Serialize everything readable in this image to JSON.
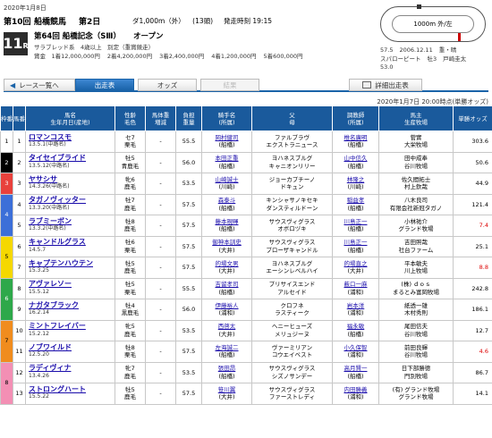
{
  "header": {
    "date": "2020年1月8日",
    "race_no": "第10回",
    "track": "船橋競馬",
    "day": "第2日",
    "distance": "ダ1,000m（外）",
    "runners": "(13頭)",
    "post_time": "発走時刻 19:15",
    "race_number_big": "11",
    "race_number_suffix": "R",
    "race_name": "第64回 船橋記念（SⅢ）",
    "race_class": "オープン",
    "conditions": "サラブレッド系　4歳以上　別定（重賞競走）",
    "prizes": [
      "賞金　1着12,000,000円",
      "2着4,200,000円",
      "3着2,400,000円",
      "4着1,200,000円",
      "5着600,000円"
    ]
  },
  "course": {
    "label": "1000m 外/左",
    "sub": "内"
  },
  "record": {
    "line1": [
      "57.5",
      "2006.12.11",
      "重・晴"
    ],
    "line2": [
      "スパローピート",
      "牡3",
      "戸崎圭太"
    ],
    "line3": [
      "53.0"
    ]
  },
  "nav": {
    "back": "レース一覧へ",
    "tabs": [
      "出走表",
      "オッズ",
      "結果"
    ],
    "detail": "詳細出走表"
  },
  "timestamp": "2020年1月7日 20:00時点(単勝オッズ)",
  "columns": [
    "枠番",
    "馬番",
    "馬名\n生年月日(産地)",
    "性齢\n毛色",
    "馬体重\n増減",
    "負担\n重量",
    "騎手名\n(所属)",
    "父\n母",
    "調教師\n(所属)",
    "馬主\n生産牧場",
    "単勝オッズ"
  ],
  "frame_colors": [
    "#ffffff",
    "#000000",
    "#e8413c",
    "#3c6fd8",
    "#f5d800",
    "#2ea84a",
    "#f08c1e",
    "#f38fb4"
  ],
  "rows": [
    {
      "waku": "1",
      "no": "1",
      "name": "ロマンコスモ",
      "birth": "13.5.1(中路名)",
      "sex": "セ7",
      "color": "栗毛",
      "wt": "-",
      "wtd": "",
      "load": "55.5",
      "jockey": "岡村健司",
      "jaff": "(船橋)",
      "sire": "ファルブラヴ",
      "dam": "エクストラニュース",
      "trainer": "椎名廣明",
      "taff": "(船橋)",
      "owner": "菅實",
      "farm": "大栄牧場",
      "odds": "303.6",
      "red": false
    },
    {
      "waku": "2",
      "no": "2",
      "name": "タイセイブライド",
      "birth": "13.5.12(中路名)",
      "sex": "牡5",
      "color": "青鹿毛",
      "wt": "-",
      "wtd": "",
      "load": "56.0",
      "jockey": "本田正重",
      "jaff": "(船橋)",
      "sire": "ヨハネスブルグ",
      "dam": "キャニオンリリー",
      "trainer": "山中信久",
      "taff": "(船橋)",
      "owner": "田中成奉",
      "farm": "谷川牧場",
      "odds": "50.6",
      "red": false
    },
    {
      "waku": "3",
      "no": "3",
      "name": "ヤサシサ",
      "birth": "14.3.26(中路名)",
      "sex": "牝6",
      "color": "鹿毛",
      "wt": "-",
      "wtd": "",
      "load": "53.5",
      "jockey": "山崎誠士",
      "jaff": "(川崎)",
      "sire": "ジョーカプチーノ",
      "dam": "ドキュン",
      "trainer": "林隆之",
      "taff": "(川崎)",
      "owner": "佐久間拓士",
      "farm": "村上欽哉",
      "odds": "44.9",
      "red": false
    },
    {
      "waku": "4",
      "no": "4",
      "name": "タガノヴィッター",
      "birth": "13.3.20(中路名)",
      "sex": "牡7",
      "color": "鹿毛",
      "wt": "-",
      "wtd": "",
      "load": "57.5",
      "jockey": "森泰斗",
      "jaff": "(船橋)",
      "sire": "キンシャサノキセキ",
      "dam": "ダンスティルドーン",
      "trainer": "稲益孝",
      "taff": "(船橋)",
      "owner": "八木良司",
      "farm": "有限会社新冠タガノ",
      "odds": "121.4",
      "red": false
    },
    {
      "waku": "4",
      "no": "5",
      "name": "ラブミーボン",
      "birth": "13.3.2(中路名)",
      "sex": "牡8",
      "color": "鹿毛",
      "wt": "-",
      "wtd": "",
      "load": "57.5",
      "jockey": "藤本現暉",
      "jaff": "(船橋)",
      "sire": "サウスヴィグラス",
      "dam": "オボロヅキ",
      "trainer": "川島正一",
      "taff": "(船橋)",
      "owner": "小林祐介",
      "farm": "グランド牧場",
      "odds": "7.4",
      "red": true
    },
    {
      "waku": "5",
      "no": "6",
      "name": "キャンドルグラス",
      "birth": "14.5.7",
      "sex": "牡6",
      "color": "栗毛",
      "wt": "-",
      "wtd": "",
      "load": "57.5",
      "jockey": "御神本訓史",
      "jaff": "(大井)",
      "sire": "サウスヴィグラス",
      "dam": "ブローザキャンドル",
      "trainer": "川島正一",
      "taff": "(船橋)",
      "owner": "吉田照哉",
      "farm": "社台ファーム",
      "odds": "25.1",
      "red": false
    },
    {
      "waku": "5",
      "no": "7",
      "name": "キャプテンハウテン",
      "birth": "15.3.25",
      "sex": "牡5",
      "color": "鹿毛",
      "wt": "-",
      "wtd": "",
      "load": "57.5",
      "jockey": "的場文男",
      "jaff": "(大井)",
      "sire": "ヨハネスブルグ",
      "dam": "エーシンレベルハイ",
      "trainer": "的場直之",
      "taff": "(大井)",
      "owner": "平本敏夫",
      "farm": "川上牧場",
      "odds": "8.8",
      "red": true
    },
    {
      "waku": "6",
      "no": "8",
      "name": "アヴァレソー",
      "birth": "15.5.12",
      "sex": "牡5",
      "color": "栗毛",
      "wt": "-",
      "wtd": "",
      "load": "55.5",
      "jockey": "吉留孝司",
      "jaff": "(船橋)",
      "sire": "プリサイスエンド",
      "dam": "アルセイド",
      "trainer": "薮口一麻",
      "taff": "(浦和)",
      "owner": "(株) ｄｏｓ",
      "farm": "まるとみ富岡牧場",
      "odds": "242.8",
      "red": false
    },
    {
      "waku": "6",
      "no": "9",
      "name": "ナガタブラック",
      "birth": "16.2.14",
      "sex": "牡4",
      "color": "黒鹿毛",
      "wt": "-",
      "wtd": "",
      "load": "56.0",
      "jockey": "伊藤裕人",
      "jaff": "(浦和)",
      "sire": "クロフネ",
      "dam": "ラスティーク",
      "trainer": "岩本洋",
      "taff": "(浦和)",
      "owner": "紙透一雄",
      "farm": "木村秀則",
      "odds": "186.1",
      "red": false
    },
    {
      "waku": "7",
      "no": "10",
      "name": "ミントフレイバー",
      "birth": "15.2.12",
      "sex": "牝5",
      "color": "鹿毛",
      "wt": "-",
      "wtd": "",
      "load": "53.5",
      "jockey": "西啓太",
      "jaff": "(大井)",
      "sire": "ヘニーヒューズ",
      "dam": "メリュジーヌ",
      "trainer": "福永敏",
      "taff": "(船橋)",
      "owner": "尾田信夫",
      "farm": "谷川牧場",
      "odds": "12.7",
      "red": false
    },
    {
      "waku": "7",
      "no": "11",
      "name": "ノブワイルド",
      "birth": "12.5.20",
      "sex": "牡8",
      "color": "栗毛",
      "wt": "-",
      "wtd": "",
      "load": "57.5",
      "jockey": "左海誠二",
      "jaff": "(船橋)",
      "sire": "ヴァーミリアン",
      "dam": "コウエイベスト",
      "trainer": "小久保智",
      "taff": "(浦和)",
      "owner": "前田良輝",
      "farm": "谷川牧場",
      "odds": "4.6",
      "red": true
    },
    {
      "waku": "8",
      "no": "12",
      "name": "ラディヴィナ",
      "birth": "13.4.26",
      "sex": "牝7",
      "color": "鹿毛",
      "wt": "-",
      "wtd": "",
      "load": "53.5",
      "jockey": "張田昂",
      "jaff": "(船橋)",
      "sire": "サウスヴィグラス",
      "dam": "シズノサンデー",
      "trainer": "高月賢一",
      "taff": "(船橋)",
      "owner": "日下部勝德",
      "farm": "門別牧場",
      "odds": "86.7",
      "red": false
    },
    {
      "waku": "8",
      "no": "13",
      "name": "ストロングハート",
      "birth": "15.5.22",
      "sex": "牡5",
      "color": "鹿毛",
      "wt": "-",
      "wtd": "",
      "load": "57.5",
      "jockey": "笹川翼",
      "jaff": "(大井)",
      "sire": "サウスヴィグラス",
      "dam": "ファーストレディ",
      "trainer": "内田勝義",
      "taff": "(浦和)",
      "owner": "(有) グランド牧場",
      "farm": "グランド牧場",
      "odds": "14.1",
      "red": false
    }
  ]
}
